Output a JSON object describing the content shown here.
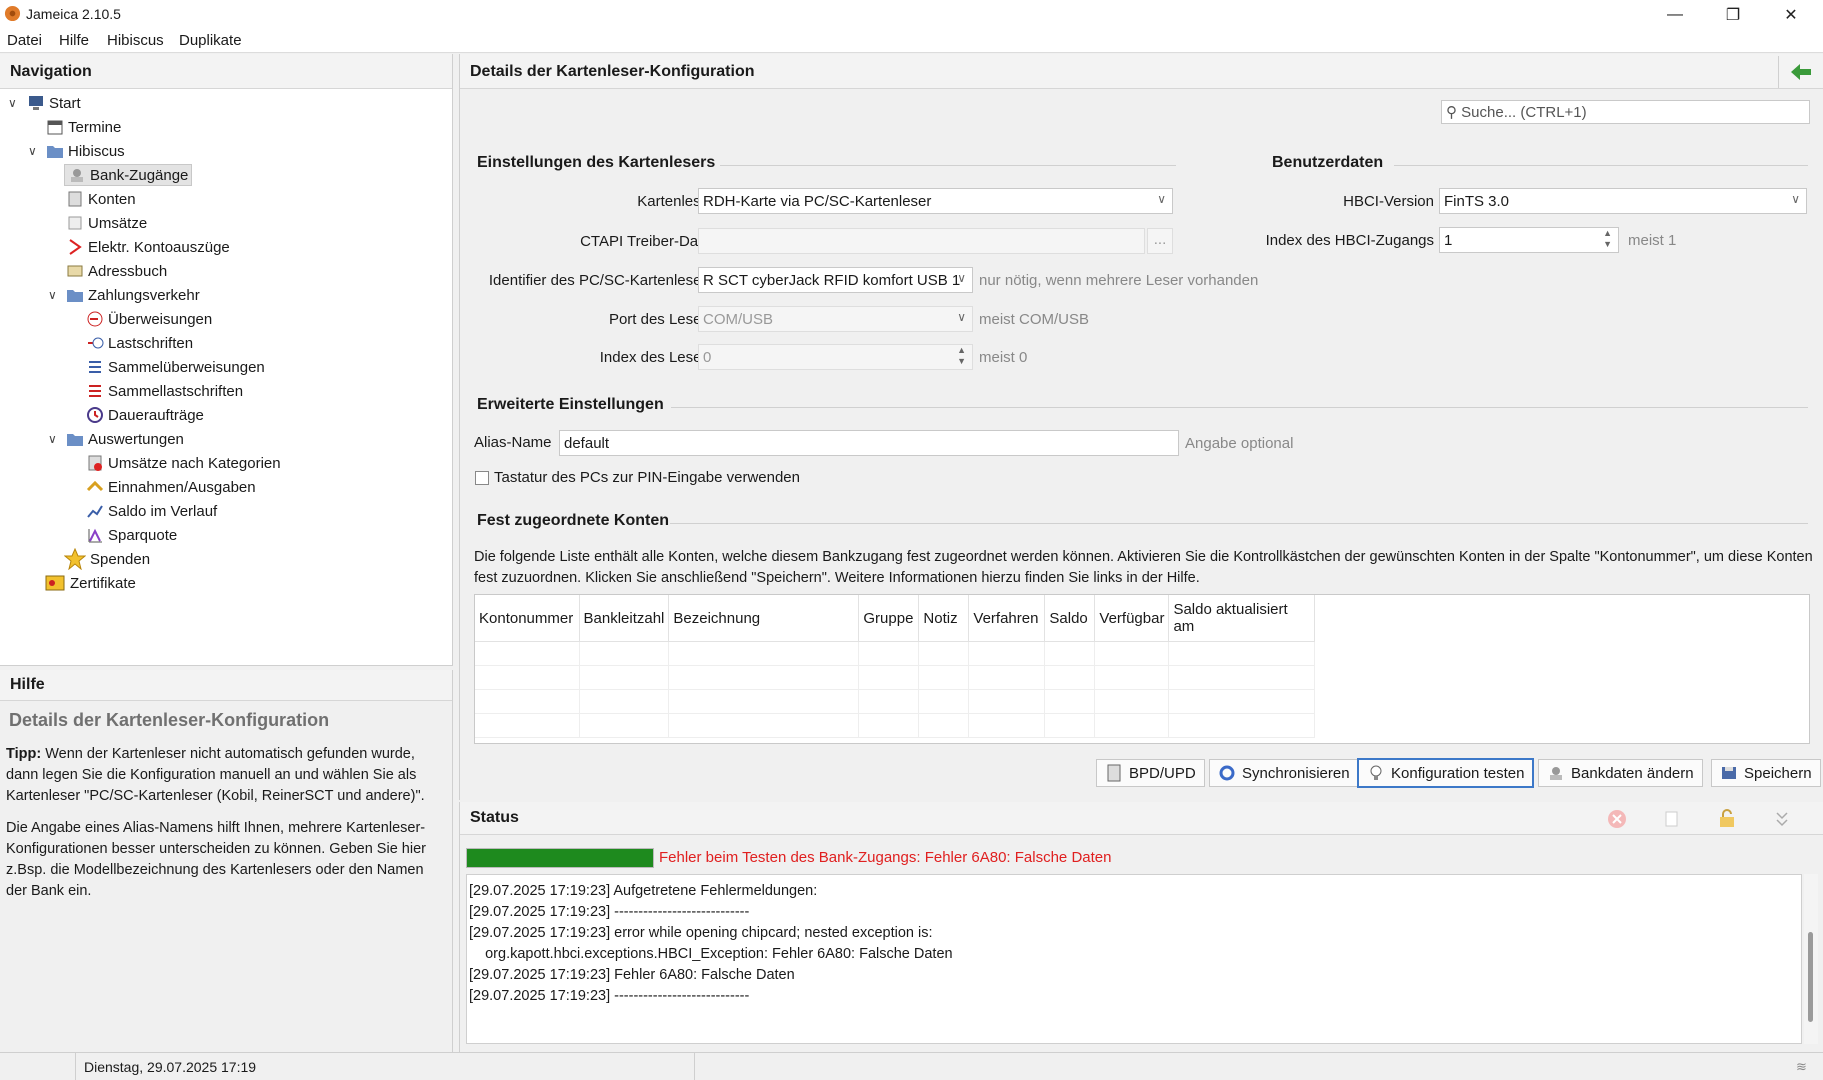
{
  "window": {
    "title": "Jameica 2.10.5"
  },
  "menu": [
    "Datei",
    "Hilfe",
    "Hibiscus",
    "Duplikate"
  ],
  "navigation": {
    "header": "Navigation",
    "items": [
      {
        "label": "Start"
      },
      {
        "label": "Termine"
      },
      {
        "label": "Hibiscus"
      },
      {
        "label": "Bank-Zugänge"
      },
      {
        "label": "Konten"
      },
      {
        "label": "Umsätze"
      },
      {
        "label": "Elektr. Kontoauszüge"
      },
      {
        "label": "Adressbuch"
      },
      {
        "label": "Zahlungsverkehr"
      },
      {
        "label": "Überweisungen"
      },
      {
        "label": "Lastschriften"
      },
      {
        "label": "Sammelüberweisungen"
      },
      {
        "label": "Sammellastschriften"
      },
      {
        "label": "Daueraufträge"
      },
      {
        "label": "Auswertungen"
      },
      {
        "label": "Umsätze nach Kategorien"
      },
      {
        "label": "Einnahmen/Ausgaben"
      },
      {
        "label": "Saldo im Verlauf"
      },
      {
        "label": "Sparquote"
      },
      {
        "label": "Spenden"
      },
      {
        "label": "Zertifikate"
      }
    ]
  },
  "help": {
    "header": "Hilfe",
    "title": "Details der Kartenleser-Konfiguration",
    "tip_label": "Tipp:",
    "tip_text": " Wenn der Kartenleser nicht automatisch gefunden wurde, dann legen Sie die Konfiguration manuell an und wählen Sie als Kartenleser \"PC/SC-Kartenleser (Kobil, ReinerSCT und andere)\".",
    "para2": "Die Angabe eines Alias-Namens hilft Ihnen, mehrere Kartenleser-Konfigurationen besser unterscheiden zu können. Geben Sie hier z.Bsp. die Modellbezeichnung des Kartenlesers oder den Namen der Bank ein."
  },
  "main": {
    "header": "Details der Kartenleser-Konfiguration",
    "search_placeholder": "Suche...   (CTRL+1)",
    "reader_section": "Einstellungen des Kartenlesers",
    "user_section": "Benutzerdaten",
    "kartenleser_label": "Kartenleser",
    "kartenleser_value": "RDH-Karte via PC/SC-Kartenleser",
    "ctapi_label": "CTAPI Treiber-Datei",
    "ctapi_btn": "...",
    "identifier_label": "Identifier des PC/SC-Kartenlesers",
    "identifier_value": "R SCT cyberJack RFID komfort USB 1",
    "identifier_hint": "nur nötig, wenn mehrere Leser vorhanden",
    "port_label": "Port des Lesers",
    "port_value": "COM/USB",
    "port_hint": "meist COM/USB",
    "index_label": "Index des Lesers",
    "index_value": "0",
    "index_hint": "meist 0",
    "hbci_label": "HBCI-Version",
    "hbci_value": "FinTS 3.0",
    "hbci_index_label": "Index des HBCI-Zugangs",
    "hbci_index_value": "1",
    "hbci_index_hint": "meist 1",
    "advanced_section": "Erweiterte Einstellungen",
    "alias_label": "Alias-Name",
    "alias_value": "default",
    "alias_hint": "Angabe optional",
    "pin_checkbox_label": "Tastatur des PCs zur PIN-Eingabe verwenden",
    "accounts_section": "Fest zugeordnete Konten",
    "accounts_desc": "Die folgende Liste enthält alle Konten, welche diesem Bankzugang fest zugeordnet werden können. Aktivieren Sie die Kontrollkästchen der gewünschten Konten in der Spalte \"Kontonummer\", um diese Konten fest zuzuordnen. Klicken Sie anschließend \"Speichern\". Weitere Informationen hierzu finden Sie links in der Hilfe.",
    "columns": [
      "Kontonummer",
      "Bankleitzahl",
      "Bezeichnung",
      "Gruppe",
      "Notiz",
      "Verfahren",
      "Saldo",
      "Verfügbar",
      "Saldo aktualisiert am"
    ],
    "buttons": {
      "bpd": "BPD/UPD",
      "sync": "Synchronisieren",
      "test": "Konfiguration testen",
      "bankdata": "Bankdaten ändern",
      "save": "Speichern"
    }
  },
  "status": {
    "header": "Status",
    "progress_fraction": 1.0,
    "error_message": "Fehler beim Testen des Bank-Zugangs: Fehler 6A80: Falsche Daten",
    "log": [
      "[29.07.2025 17:19:23] Aufgetretene Fehlermeldungen:",
      "[29.07.2025 17:19:23] ----------------------------",
      "[29.07.2025 17:19:23]   error while opening chipcard; nested exception is:",
      "    org.kapott.hbci.exceptions.HBCI_Exception: Fehler 6A80: Falsche Daten",
      "[29.07.2025 17:19:23]   Fehler 6A80: Falsche Daten",
      "[29.07.2025 17:19:23] ----------------------------"
    ]
  },
  "footer": {
    "date": "Dienstag, 29.07.2025 17:19"
  },
  "colors": {
    "progress": "#1e8a1e",
    "error": "#e02020",
    "focus": "#3c78c8"
  }
}
